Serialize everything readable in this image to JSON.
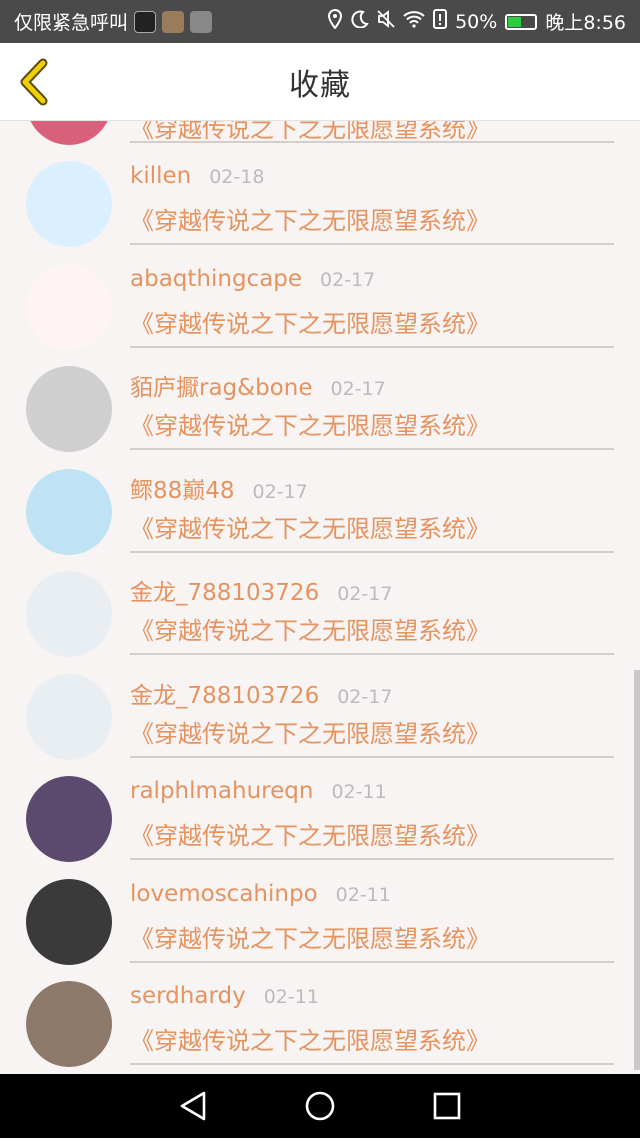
{
  "status_bar": {
    "left_text": "仅限紧急呼叫",
    "battery": "50%",
    "battery_level": 0.5,
    "time": "晚上8:56"
  },
  "header": {
    "title": "收藏"
  },
  "partial_novel": "《穿越传说之下之无限愿望系统》",
  "items": [
    {
      "name": "killen",
      "date": "02-18",
      "novel": "《穿越传说之下之无限愿望系统》",
      "avatar_color": "#dcefff"
    },
    {
      "name": "abaqthingcape",
      "date": "02-17",
      "novel": "《穿越传说之下之无限愿望系统》",
      "avatar_color": "#fff4f4"
    },
    {
      "name": "貊庐擫rag&bone",
      "date": "02-17",
      "novel": "《穿越传说之下之无限愿望系统》",
      "avatar_color": "#cfcfcf"
    },
    {
      "name": "鳏88巅48",
      "date": "02-17",
      "novel": "《穿越传说之下之无限愿望系统》",
      "avatar_color": "#bfe2f4"
    },
    {
      "name": "金龙_788103726",
      "date": "02-17",
      "novel": "《穿越传说之下之无限愿望系统》",
      "avatar_color": "#e9eef2"
    },
    {
      "name": "金龙_788103726",
      "date": "02-17",
      "novel": "《穿越传说之下之无限愿望系统》",
      "avatar_color": "#e9eef2"
    },
    {
      "name": "ralphlmahureqn",
      "date": "02-11",
      "novel": "《穿越传说之下之无限愿望系统》",
      "avatar_color": "#5b4a6e"
    },
    {
      "name": "lovemoscahinpo",
      "date": "02-11",
      "novel": "《穿越传说之下之无限愿望系统》",
      "avatar_color": "#3a3a3a"
    },
    {
      "name": "serdhardy",
      "date": "02-11",
      "novel": "《穿越传说之下之无限愿望系统》",
      "avatar_color": "#8d7a6b"
    }
  ]
}
